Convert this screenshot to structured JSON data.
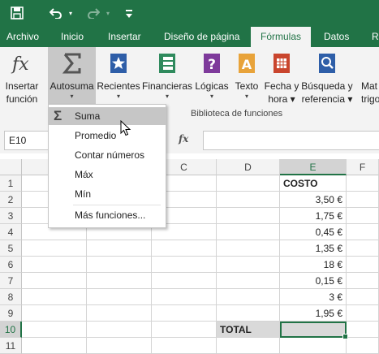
{
  "quick_access": {
    "save_icon": "save-icon",
    "undo_icon": "undo-icon",
    "redo_icon": "redo-icon",
    "customize_icon": "customize-qat-icon"
  },
  "tabs": [
    {
      "label": "Archivo"
    },
    {
      "label": "Inicio"
    },
    {
      "label": "Insertar"
    },
    {
      "label": "Diseño de página"
    },
    {
      "label": "Fórmulas",
      "active": true
    },
    {
      "label": "Datos"
    },
    {
      "label": "R"
    }
  ],
  "ribbon": {
    "buttons": [
      {
        "line1": "Insertar",
        "line2": "función",
        "icon": "fx-icon"
      },
      {
        "line1": "Autosuma",
        "line2": "▾",
        "icon": "sigma-icon",
        "pressed": true
      },
      {
        "line1": "Recientes",
        "line2": "▾",
        "icon": "star-book-icon"
      },
      {
        "line1": "Financieras",
        "line2": "▾",
        "icon": "money-book-icon"
      },
      {
        "line1": "Lógicas",
        "line2": "▾",
        "icon": "question-book-icon"
      },
      {
        "line1": "Texto",
        "line2": "▾",
        "icon": "text-book-icon"
      },
      {
        "line1": "Fecha y",
        "line2": "hora ▾",
        "icon": "calendar-book-icon"
      },
      {
        "line1": "Búsqueda y",
        "line2": "referencia ▾",
        "icon": "search-book-icon"
      },
      {
        "line1": "Mat",
        "line2": "trigor",
        "icon": "math-book-icon"
      }
    ],
    "group_label": "Biblioteca de funciones"
  },
  "formula_bar": {
    "name_box": "E10",
    "fx_label": "fx",
    "value": ""
  },
  "autosum_menu": {
    "items": [
      {
        "label": "Suma",
        "highlighted": true,
        "icon": "sigma-icon"
      },
      {
        "label": "Promedio"
      },
      {
        "label": "Contar números"
      },
      {
        "label": "Máx"
      },
      {
        "label": "Mín"
      },
      {
        "label": "Más funciones..."
      }
    ]
  },
  "sheet": {
    "columns": [
      "C",
      "D",
      "E",
      "F"
    ],
    "selected_column": "E",
    "rows": [
      "1",
      "2",
      "3",
      "4",
      "5",
      "6",
      "7",
      "8",
      "9",
      "10",
      "11"
    ],
    "selected_row": "10",
    "cells": {
      "E1": "COSTO",
      "E2": "3,50 €",
      "E3": "1,75 €",
      "E4": "0,45 €",
      "E5": "1,35 €",
      "E6": "18 €",
      "E7": "0,15 €",
      "E8": "3 €",
      "E9": "1,95 €",
      "D10": "TOTAL",
      "E10": ""
    }
  },
  "colors": {
    "brand_green": "#217346",
    "ribbon_bg": "#f3f3f3",
    "total_shade": "#d9d9d9"
  }
}
